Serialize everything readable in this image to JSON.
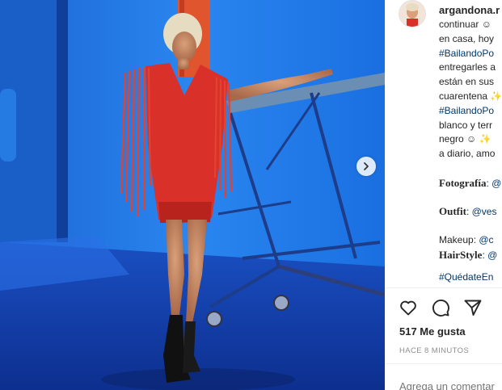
{
  "post": {
    "username": "argandona.r",
    "caption_lines": [
      "continuar ☺",
      "en casa, hoy",
      "#BailandoPo",
      "entregarles a",
      "están en sus",
      "cuarentena ✨",
      "#BailandoPo",
      "blanco y terr",
      "negro ☺ ✨",
      "a diario, amo"
    ],
    "credits": {
      "photo_label": "Fotografía",
      "photo_value": ": @",
      "outfit_label": "Outfit",
      "outfit_value": ": @ves",
      "makeup_label": "Makeup",
      "makeup_value": ": @c",
      "hair_label": "HairStyle",
      "hair_value": ": @"
    },
    "last_tag": "#QuédateEn",
    "likes": "517 Me gusta",
    "time": "HACE 8 MINUTOS",
    "comment_placeholder": "Agrega un comentar"
  },
  "icons": [
    "heart-icon",
    "comment-icon",
    "share-icon",
    "chevron-right-icon"
  ],
  "colors": {
    "link": "#00376b",
    "text": "#262626",
    "muted": "#8e8e8e",
    "dress": "#d9302a",
    "wall": "#1f6fd8"
  }
}
